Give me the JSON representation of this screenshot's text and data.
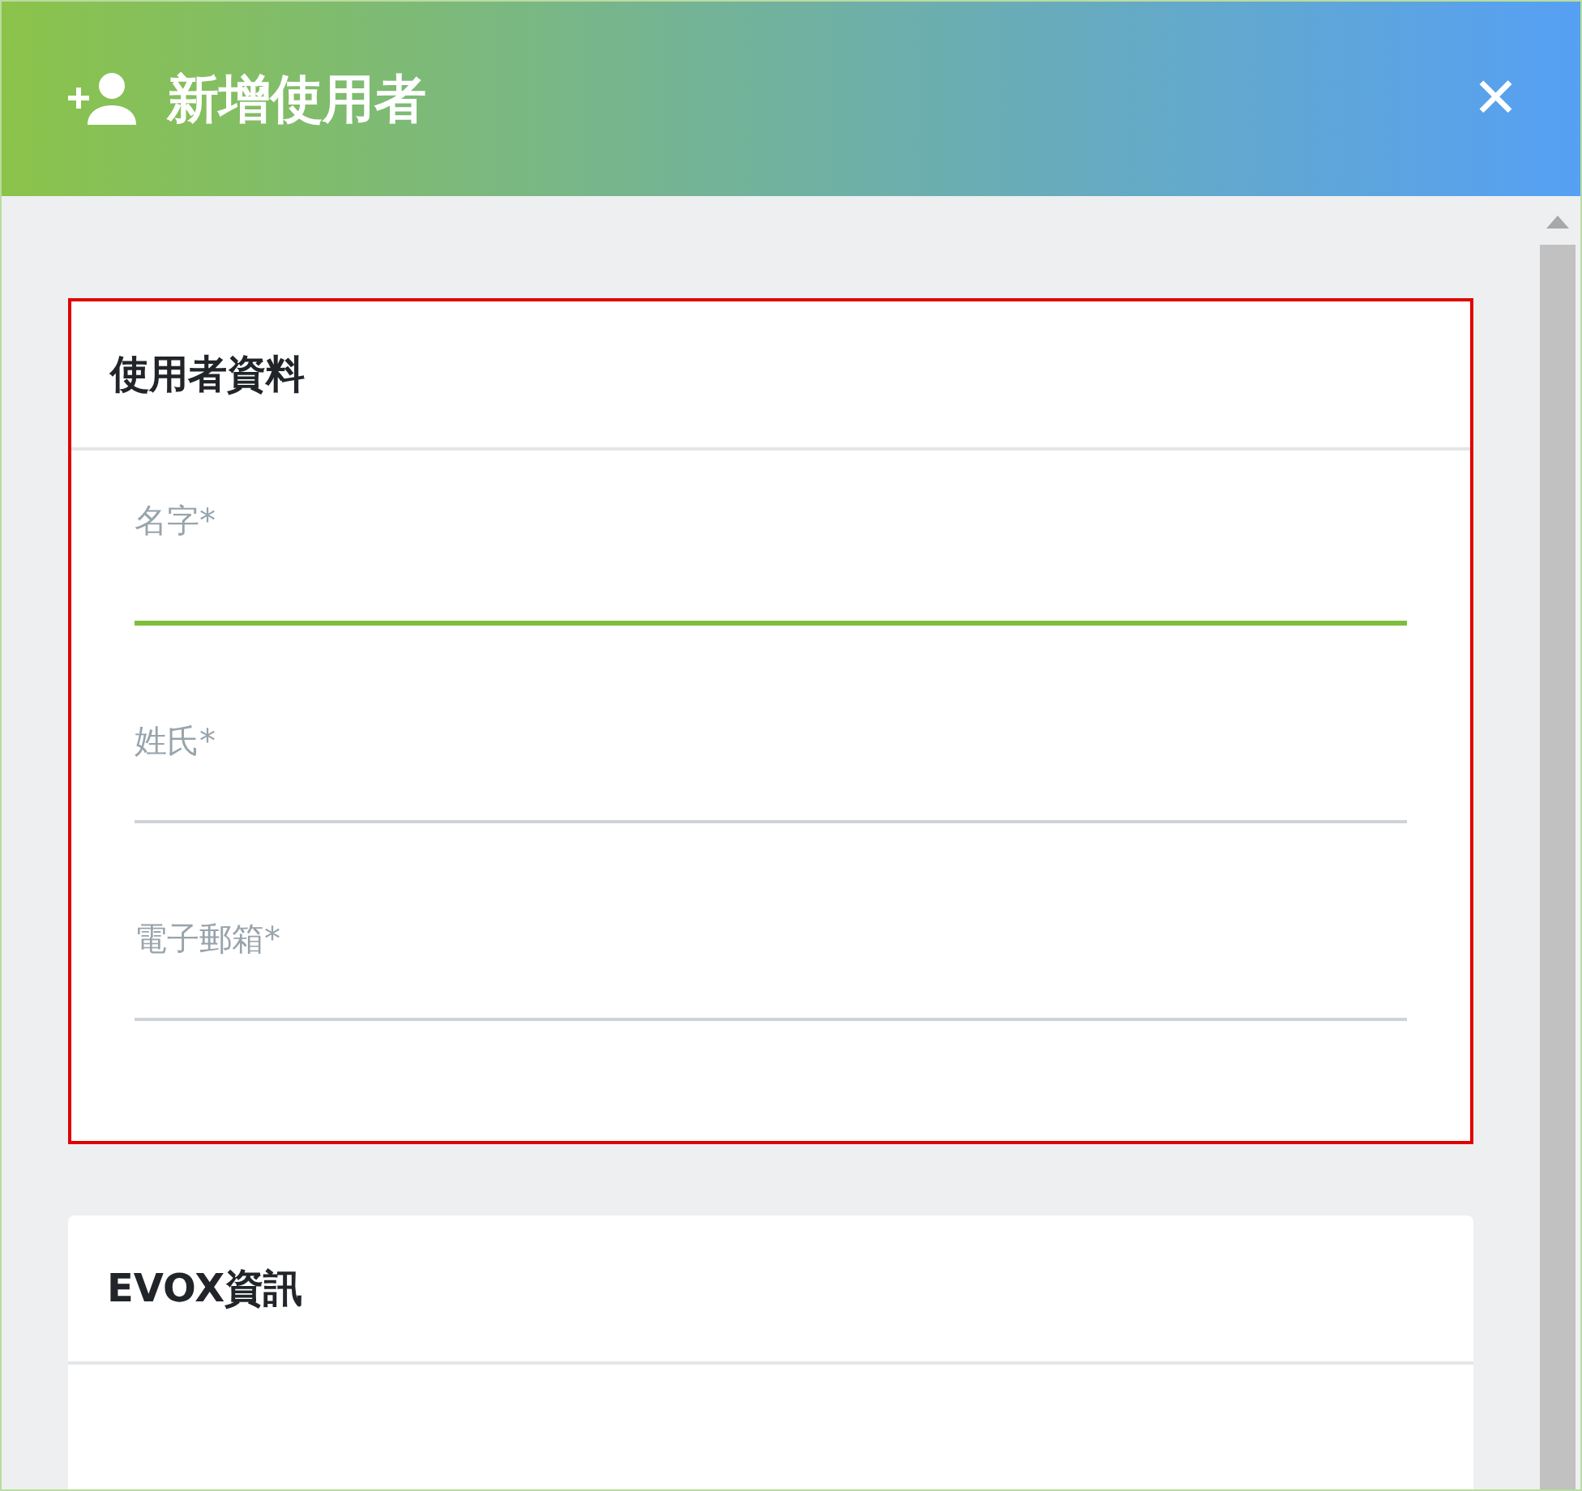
{
  "dialog": {
    "title": "新增使用者",
    "close": "✕"
  },
  "sections": [
    {
      "title": "使用者資料",
      "highlighted": true,
      "fields": [
        {
          "label": "名字*",
          "focused": true
        },
        {
          "label": "姓氏*",
          "focused": false
        },
        {
          "label": "電子郵箱*",
          "focused": false
        }
      ]
    },
    {
      "title": "EVOX資訊",
      "highlighted": false
    }
  ]
}
